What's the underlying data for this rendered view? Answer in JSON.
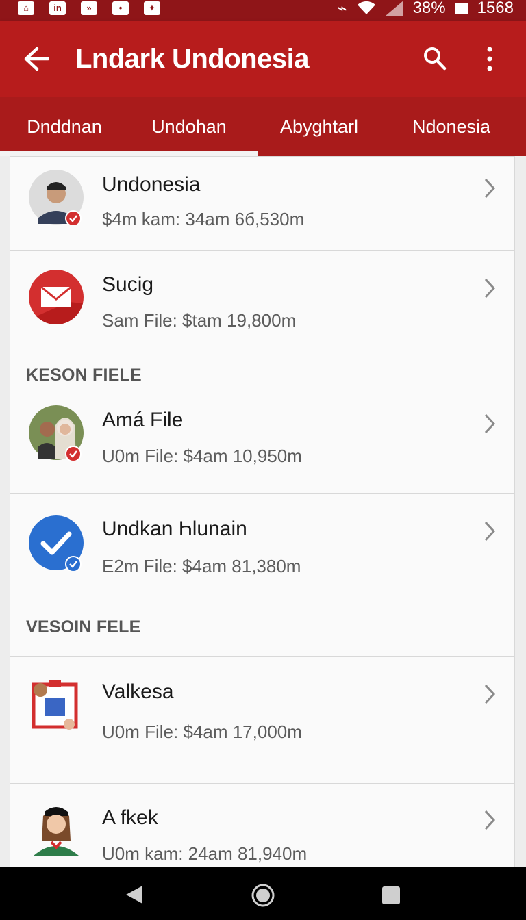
{
  "status_bar": {
    "left_icons": [
      "home-icon",
      "linkedin-icon",
      "media-icon",
      "notification-icon",
      "sparkle-icon"
    ],
    "battery_percent": "38%",
    "time": "1568"
  },
  "app_bar": {
    "title": "Lndark Undonesia",
    "back_icon": "arrow-left-icon",
    "search_icon": "search-icon",
    "menu_icon": "more-vert-icon"
  },
  "tabs": [
    {
      "label": "Dnddnan",
      "selected": true
    },
    {
      "label": "Undohan",
      "selected": false
    },
    {
      "label": "Abyghtarl",
      "selected": false
    },
    {
      "label": "Ndonesia",
      "selected": false
    }
  ],
  "colors": {
    "primary": "#b71c1c",
    "primary_dark": "#8f1518",
    "accent": "#d32f2f",
    "check_blue": "#2a6fd0"
  },
  "list": {
    "items": [
      {
        "title": "Undonesia",
        "subtitle": "$4m kam: 34am 6б,530m",
        "icon": "person-avatar",
        "badge": "check-red"
      },
      {
        "title": "Sucig",
        "subtitle": "Sam File: $tam 19,800m",
        "icon": "mail-icon"
      },
      {
        "title": "Amá File",
        "subtitle": "U0m File: $4am 10,950m",
        "icon": "group-photo-avatar",
        "badge": "check-red"
      },
      {
        "title": "Undkan Һlunain",
        "subtitle": "E2m File: $4am 81,380m",
        "icon": "check-circle-icon",
        "badge": "check-blue"
      },
      {
        "title": "Valkesa",
        "subtitle": "U0m File: $4am 17,000m",
        "icon": "clipboard-hand-icon"
      },
      {
        "title": "A fkek",
        "subtitle": "U0m kam: 24am 81,940m",
        "icon": "woman-avatar"
      }
    ],
    "sections": [
      "KESON FIELE",
      "VESOIN FELE"
    ]
  },
  "nav": {
    "back": "nav-back-icon",
    "home": "nav-home-icon",
    "recents": "nav-recents-icon"
  }
}
